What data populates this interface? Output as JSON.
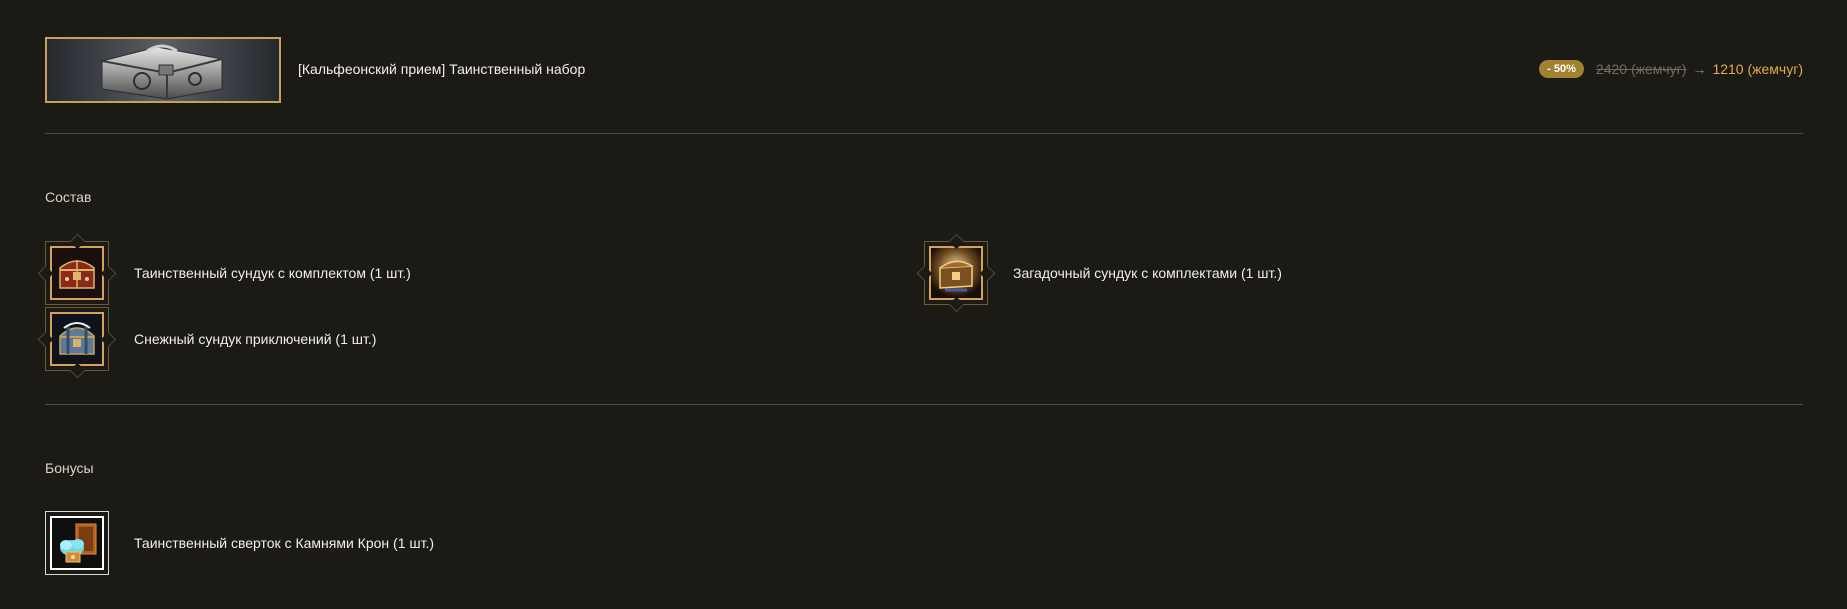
{
  "product": {
    "title": "[Кальфеонский прием] Таинственный набор",
    "banner_icon": "silver-chest-banner",
    "discount": "- 50%",
    "old_price": "2420 (жемчуг)",
    "arrow": "→",
    "new_price": "1210 (жемчуг)"
  },
  "composition": {
    "title": "Состав",
    "items": [
      {
        "label": "Таинственный сундук с комплектом (1 шт.)",
        "icon": "red-chest-icon"
      },
      {
        "label": "Загадочный сундук с комплектами (1 шт.)",
        "icon": "golden-chest-icon"
      },
      {
        "label": "Снежный сундук приключений (1 шт.)",
        "icon": "snow-chest-icon"
      }
    ]
  },
  "bonuses": {
    "title": "Бонусы",
    "items": [
      {
        "label": "Таинственный сверток с Камнями Крон (1 шт.)",
        "icon": "crown-stones-icon"
      }
    ]
  },
  "colors": {
    "background": "#1b1a14",
    "accent_gold": "#d6a25a",
    "price_orange": "#e3a94c",
    "badge": "#a0822f"
  }
}
